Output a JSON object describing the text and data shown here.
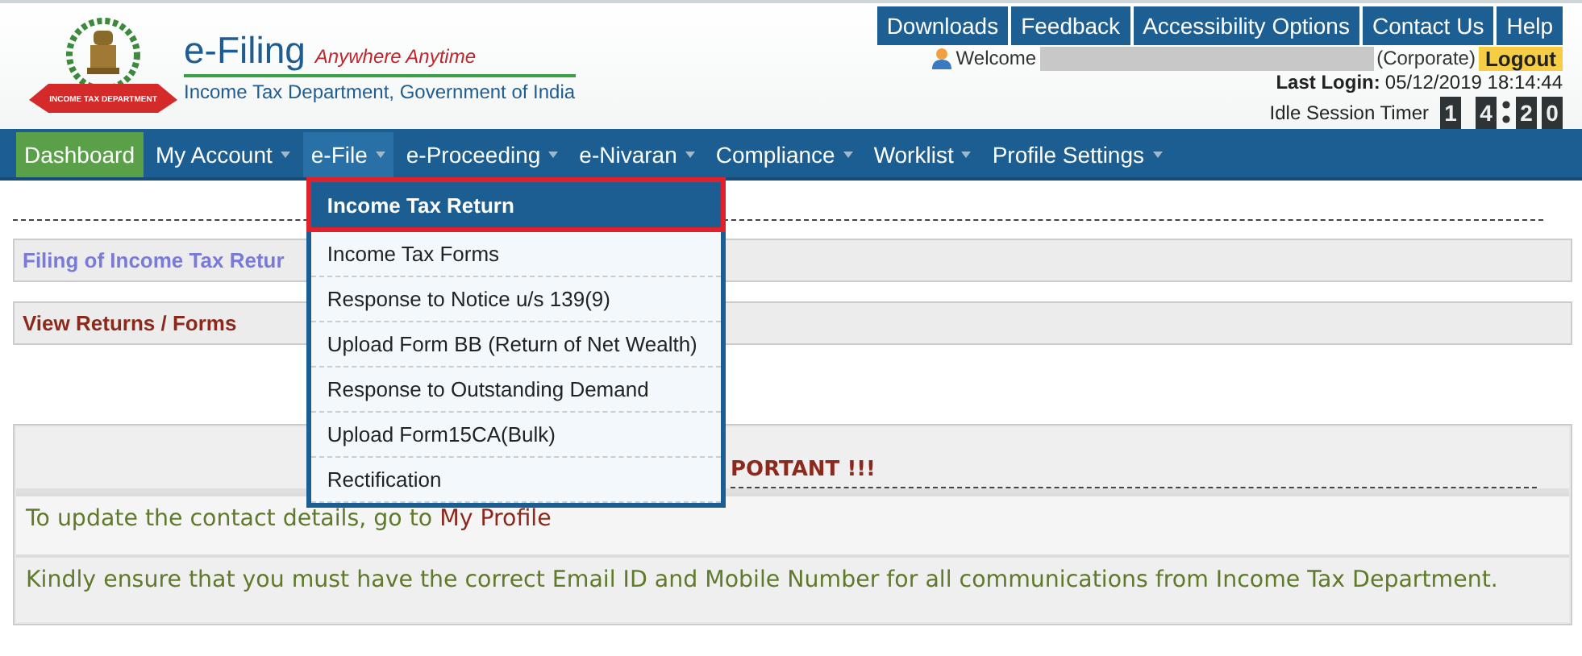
{
  "logo": {
    "ribbon": "INCOME TAX DEPARTMENT",
    "title": "e-Filing",
    "tagline": "Anywhere Anytime",
    "subtitle": "Income Tax Department, Government of India"
  },
  "top_links": [
    "Downloads",
    "Feedback",
    "Accessibility Options",
    "Contact Us",
    "Help"
  ],
  "user": {
    "welcome": "Welcome",
    "name_hidden": true,
    "role": "(Corporate)",
    "logout": "Logout"
  },
  "last_login": {
    "label": "Last Login:",
    "value": "05/12/2019 18:14:44"
  },
  "idle_timer": {
    "label": "Idle Session Timer",
    "digits": [
      "1",
      "4",
      "2",
      "0"
    ]
  },
  "nav": [
    {
      "label": "Dashboard",
      "selected": true,
      "has_menu": false,
      "expanded": false
    },
    {
      "label": "My Account",
      "selected": false,
      "has_menu": true,
      "expanded": false
    },
    {
      "label": "e-File",
      "selected": false,
      "has_menu": true,
      "expanded": true
    },
    {
      "label": "e-Proceeding",
      "selected": false,
      "has_menu": true,
      "expanded": false
    },
    {
      "label": "e-Nivaran",
      "selected": false,
      "has_menu": true,
      "expanded": false
    },
    {
      "label": "Compliance",
      "selected": false,
      "has_menu": true,
      "expanded": false
    },
    {
      "label": "Worklist",
      "selected": false,
      "has_menu": true,
      "expanded": false
    },
    {
      "label": "Profile Settings",
      "selected": false,
      "has_menu": true,
      "expanded": false
    }
  ],
  "dropdown": [
    {
      "label": "Income Tax Return",
      "selected": true
    },
    {
      "label": "Income Tax Forms",
      "selected": false
    },
    {
      "label": "Response to Notice u/s 139(9)",
      "selected": false
    },
    {
      "label": "Upload Form BB (Return of Net Wealth)",
      "selected": false
    },
    {
      "label": "Response to Outstanding Demand",
      "selected": false
    },
    {
      "label": "Upload Form15CA(Bulk)",
      "selected": false
    },
    {
      "label": "Rectification",
      "selected": false
    }
  ],
  "panels": [
    {
      "kind": "blue",
      "label": "Filing of Income Tax Retur"
    },
    {
      "kind": "red",
      "label": "View Returns / Forms"
    }
  ],
  "important": {
    "heading": "PORTANT !!!",
    "lines": [
      {
        "text": "To update the contact details, go to ",
        "link": "My Profile"
      },
      {
        "text": "Kindly ensure that you must have the correct Email ID and Mobile Number for all communications from Income Tax Department."
      }
    ]
  }
}
